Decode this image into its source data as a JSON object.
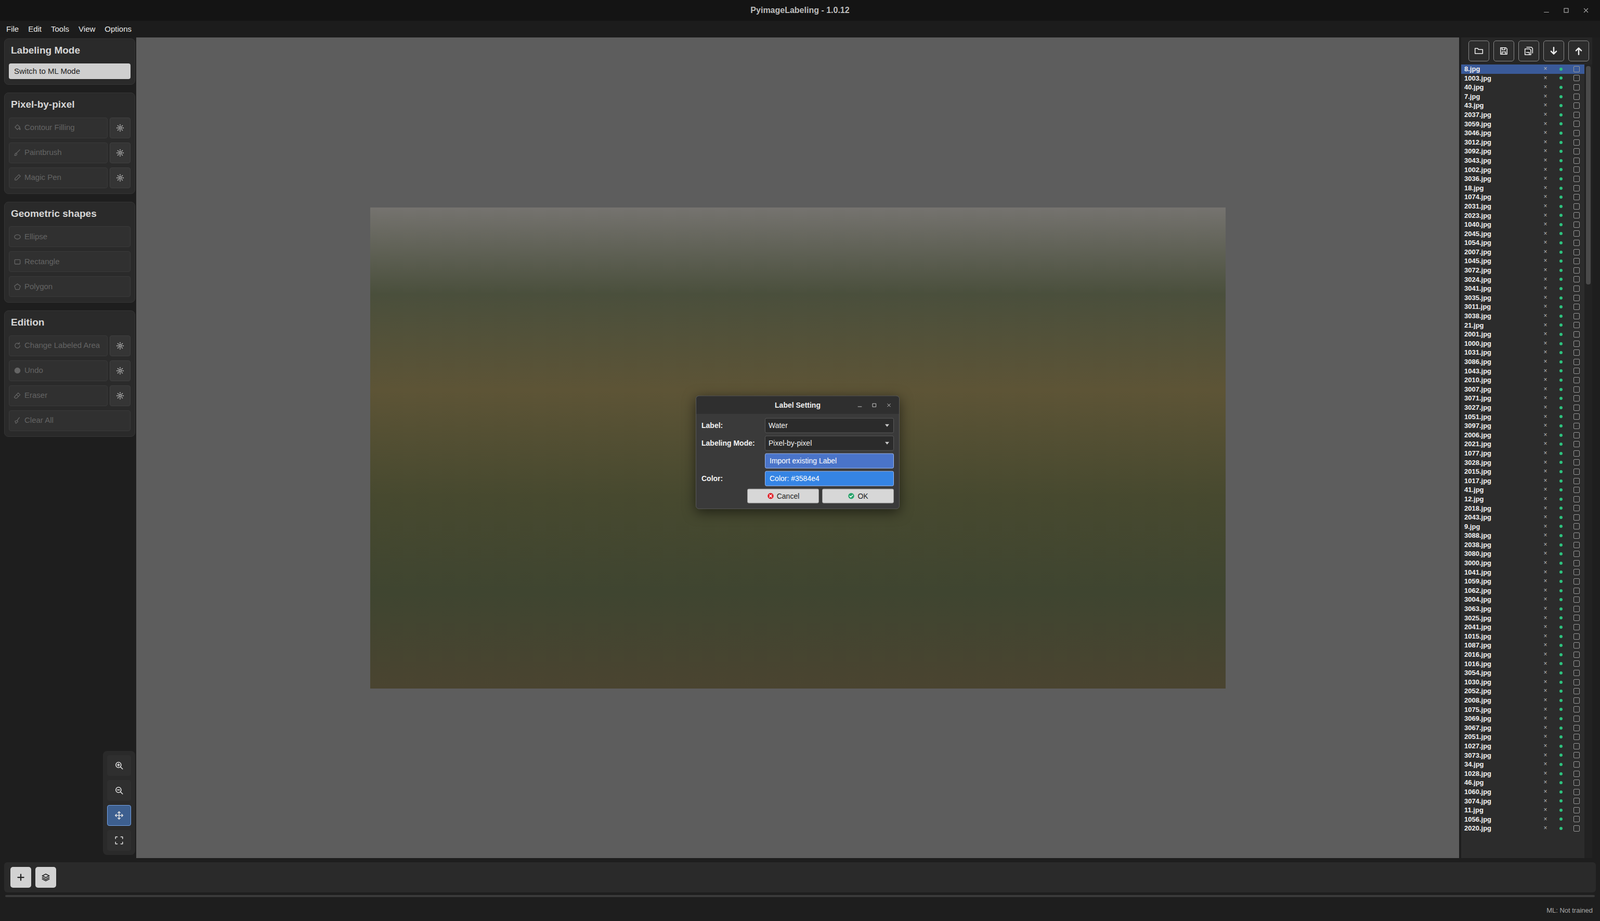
{
  "window": {
    "title": "PyimageLabeling - 1.0.12"
  },
  "menu": [
    {
      "label": "File"
    },
    {
      "label": "Edit"
    },
    {
      "label": "Tools"
    },
    {
      "label": "View"
    },
    {
      "label": "Options"
    }
  ],
  "left_panel": {
    "sections": [
      {
        "title": "Labeling Mode",
        "tools": [
          {
            "label": "Switch to ML Mode",
            "kind": "mode",
            "disabled": false,
            "settings": false
          }
        ]
      },
      {
        "title": "Pixel-by-pixel",
        "tools": [
          {
            "label": "Contour Filling",
            "kind": "tool",
            "disabled": true,
            "settings": true
          },
          {
            "label": "Paintbrush",
            "kind": "tool",
            "disabled": true,
            "settings": true
          },
          {
            "label": "Magic Pen",
            "kind": "tool",
            "disabled": true,
            "settings": true
          }
        ]
      },
      {
        "title": "Geometric shapes",
        "tools": [
          {
            "label": "Ellipse",
            "kind": "tool",
            "disabled": true,
            "settings": false
          },
          {
            "label": "Rectangle",
            "kind": "tool",
            "disabled": true,
            "settings": false
          },
          {
            "label": "Polygon",
            "kind": "tool",
            "disabled": true,
            "settings": false
          }
        ]
      },
      {
        "title": "Edition",
        "tools": [
          {
            "label": "Change Labeled Area",
            "kind": "tool",
            "disabled": true,
            "settings": true
          },
          {
            "label": "Undo",
            "kind": "tool",
            "disabled": true,
            "settings": true
          },
          {
            "label": "Eraser",
            "kind": "tool",
            "disabled": true,
            "settings": true
          },
          {
            "label": "Clear All",
            "kind": "tool",
            "disabled": true,
            "settings": false
          }
        ]
      }
    ]
  },
  "zoom_tools": [
    {
      "selected": false
    },
    {
      "selected": false
    },
    {
      "selected": true
    },
    {
      "selected": false
    }
  ],
  "dialog": {
    "title": "Label Setting",
    "fields": [
      {
        "label": "Label:",
        "value": "Water"
      },
      {
        "label": "Labeling Mode:",
        "value": "Pixel-by-pixel"
      }
    ],
    "import_button": "Import existing Label",
    "color": {
      "label": "Color:",
      "button": "Color: #3584e4",
      "color": "#3584e4"
    },
    "buttons": [
      {
        "label": "Cancel",
        "kind": "cancel"
      },
      {
        "label": "OK",
        "kind": "ok"
      }
    ]
  },
  "file_list": {
    "close_glyph": "×",
    "files": [
      {
        "name": "8.jpg",
        "selected": true,
        "checked": false
      },
      {
        "name": "1003.jpg",
        "selected": false,
        "checked": false
      },
      {
        "name": "40.jpg",
        "selected": false,
        "checked": false
      },
      {
        "name": "7.jpg",
        "selected": false,
        "checked": false
      },
      {
        "name": "43.jpg",
        "selected": false,
        "checked": false
      },
      {
        "name": "2037.jpg",
        "selected": false,
        "checked": false
      },
      {
        "name": "3059.jpg",
        "selected": false,
        "checked": false
      },
      {
        "name": "3046.jpg",
        "selected": false,
        "checked": false
      },
      {
        "name": "3012.jpg",
        "selected": false,
        "checked": false
      },
      {
        "name": "3092.jpg",
        "selected": false,
        "checked": false
      },
      {
        "name": "3043.jpg",
        "selected": false,
        "checked": false
      },
      {
        "name": "1002.jpg",
        "selected": false,
        "checked": false
      },
      {
        "name": "3036.jpg",
        "selected": false,
        "checked": false
      },
      {
        "name": "18.jpg",
        "selected": false,
        "checked": false
      },
      {
        "name": "1074.jpg",
        "selected": false,
        "checked": false
      },
      {
        "name": "2031.jpg",
        "selected": false,
        "checked": false
      },
      {
        "name": "2023.jpg",
        "selected": false,
        "checked": false
      },
      {
        "name": "1040.jpg",
        "selected": false,
        "checked": false
      },
      {
        "name": "2045.jpg",
        "selected": false,
        "checked": false
      },
      {
        "name": "1054.jpg",
        "selected": false,
        "checked": false
      },
      {
        "name": "2007.jpg",
        "selected": false,
        "checked": false
      },
      {
        "name": "1045.jpg",
        "selected": false,
        "checked": false
      },
      {
        "name": "3072.jpg",
        "selected": false,
        "checked": false
      },
      {
        "name": "3024.jpg",
        "selected": false,
        "checked": false
      },
      {
        "name": "3041.jpg",
        "selected": false,
        "checked": false
      },
      {
        "name": "3035.jpg",
        "selected": false,
        "checked": false
      },
      {
        "name": "3011.jpg",
        "selected": false,
        "checked": false
      },
      {
        "name": "3038.jpg",
        "selected": false,
        "checked": false
      },
      {
        "name": "21.jpg",
        "selected": false,
        "checked": false
      },
      {
        "name": "2001.jpg",
        "selected": false,
        "checked": false
      },
      {
        "name": "1000.jpg",
        "selected": false,
        "checked": false
      },
      {
        "name": "1031.jpg",
        "selected": false,
        "checked": false
      },
      {
        "name": "3086.jpg",
        "selected": false,
        "checked": false
      },
      {
        "name": "1043.jpg",
        "selected": false,
        "checked": false
      },
      {
        "name": "2010.jpg",
        "selected": false,
        "checked": false
      },
      {
        "name": "3007.jpg",
        "selected": false,
        "checked": false
      },
      {
        "name": "3071.jpg",
        "selected": false,
        "checked": false
      },
      {
        "name": "3027.jpg",
        "selected": false,
        "checked": false
      },
      {
        "name": "1051.jpg",
        "selected": false,
        "checked": false
      },
      {
        "name": "3097.jpg",
        "selected": false,
        "checked": false
      },
      {
        "name": "2006.jpg",
        "selected": false,
        "checked": false
      },
      {
        "name": "2021.jpg",
        "selected": false,
        "checked": false
      },
      {
        "name": "1077.jpg",
        "selected": false,
        "checked": false
      },
      {
        "name": "3028.jpg",
        "selected": false,
        "checked": false
      },
      {
        "name": "2015.jpg",
        "selected": false,
        "checked": false
      },
      {
        "name": "1017.jpg",
        "selected": false,
        "checked": false
      },
      {
        "name": "41.jpg",
        "selected": false,
        "checked": false
      },
      {
        "name": "12.jpg",
        "selected": false,
        "checked": false
      },
      {
        "name": "2018.jpg",
        "selected": false,
        "checked": false
      },
      {
        "name": "2043.jpg",
        "selected": false,
        "checked": false
      },
      {
        "name": "9.jpg",
        "selected": false,
        "checked": false
      },
      {
        "name": "3088.jpg",
        "selected": false,
        "checked": false
      },
      {
        "name": "2038.jpg",
        "selected": false,
        "checked": false
      },
      {
        "name": "3080.jpg",
        "selected": false,
        "checked": false
      },
      {
        "name": "3000.jpg",
        "selected": false,
        "checked": false
      },
      {
        "name": "1041.jpg",
        "selected": false,
        "checked": false
      },
      {
        "name": "1059.jpg",
        "selected": false,
        "checked": false
      },
      {
        "name": "1062.jpg",
        "selected": false,
        "checked": false
      },
      {
        "name": "3004.jpg",
        "selected": false,
        "checked": false
      },
      {
        "name": "3063.jpg",
        "selected": false,
        "checked": false
      },
      {
        "name": "3025.jpg",
        "selected": false,
        "checked": false
      },
      {
        "name": "2041.jpg",
        "selected": false,
        "checked": false
      },
      {
        "name": "1015.jpg",
        "selected": false,
        "checked": false
      },
      {
        "name": "1087.jpg",
        "selected": false,
        "checked": false
      },
      {
        "name": "2016.jpg",
        "selected": false,
        "checked": false
      },
      {
        "name": "1016.jpg",
        "selected": false,
        "checked": false
      },
      {
        "name": "3054.jpg",
        "selected": false,
        "checked": false
      },
      {
        "name": "1030.jpg",
        "selected": false,
        "checked": false
      },
      {
        "name": "2052.jpg",
        "selected": false,
        "checked": false
      },
      {
        "name": "2008.jpg",
        "selected": false,
        "checked": false
      },
      {
        "name": "1075.jpg",
        "selected": false,
        "checked": false
      },
      {
        "name": "3069.jpg",
        "selected": false,
        "checked": false
      },
      {
        "name": "3067.jpg",
        "selected": false,
        "checked": false
      },
      {
        "name": "2051.jpg",
        "selected": false,
        "checked": false
      },
      {
        "name": "1027.jpg",
        "selected": false,
        "checked": false
      },
      {
        "name": "3073.jpg",
        "selected": false,
        "checked": false
      },
      {
        "name": "34.jpg",
        "selected": false,
        "checked": false
      },
      {
        "name": "1028.jpg",
        "selected": false,
        "checked": false
      },
      {
        "name": "46.jpg",
        "selected": false,
        "checked": false
      },
      {
        "name": "1060.jpg",
        "selected": false,
        "checked": false
      },
      {
        "name": "3074.jpg",
        "selected": false,
        "checked": false
      },
      {
        "name": "11.jpg",
        "selected": false,
        "checked": false
      },
      {
        "name": "1056.jpg",
        "selected": false,
        "checked": false
      },
      {
        "name": "2020.jpg",
        "selected": false,
        "checked": false
      }
    ]
  },
  "status_bar": {
    "text": "ML: Not trained"
  }
}
